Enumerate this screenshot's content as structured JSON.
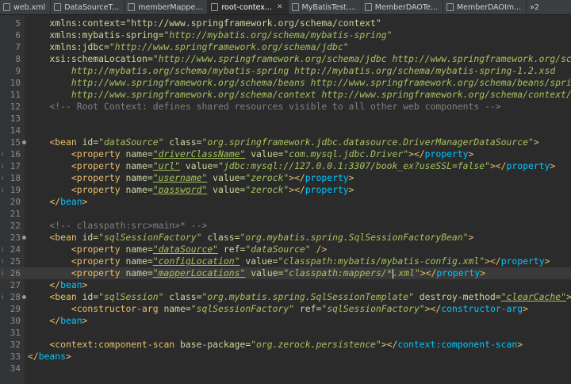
{
  "tabs": [
    {
      "label": "web.xml",
      "close": "",
      "active": false
    },
    {
      "label": "DataSourceT...",
      "close": "",
      "active": false
    },
    {
      "label": "memberMappe...",
      "close": "",
      "active": false
    },
    {
      "label": "root-contex...",
      "close": "✕",
      "active": true
    },
    {
      "label": "MyBatisTest....",
      "close": "",
      "active": false
    },
    {
      "label": "MemberDAOTe...",
      "close": "",
      "active": false
    },
    {
      "label": "MemberDAOIm...",
      "close": "",
      "active": false
    }
  ],
  "tab_overflow": "»2",
  "current_line": 26,
  "lines": [
    {
      "n": "5",
      "code": [
        [
          "a",
          "    xmlns:context=\"http://www.springframework.org/schema/context\""
        ]
      ]
    },
    {
      "n": "6",
      "code": [
        [
          "a",
          "    xmlns:mybatis-spring="
        ],
        [
          "v",
          "\"http://mybatis.org/schema/mybatis-spring\""
        ]
      ]
    },
    {
      "n": "7",
      "code": [
        [
          "a",
          "    xmlns:jdbc="
        ],
        [
          "v",
          "\"http://www.springframework.org/schema/jdbc\""
        ]
      ]
    },
    {
      "n": "8",
      "code": [
        [
          "a",
          "    xsi:schemaLocation="
        ],
        [
          "v",
          "\"http://www.springframework.org/schema/jdbc http://www.springframework.org/sch"
        ]
      ]
    },
    {
      "n": "9",
      "code": [
        [
          "v",
          "        http://mybatis.org/schema/mybatis-spring http://mybatis.org/schema/mybatis-spring-1.2.xsd"
        ]
      ]
    },
    {
      "n": "10",
      "code": [
        [
          "v",
          "        http://www.springframework.org/schema/beans http://www.springframework.org/schema/beans/spri"
        ]
      ]
    },
    {
      "n": "11",
      "code": [
        [
          "v",
          "        http://www.springframework.org/schema/context http://www.springframework.org/schema/context/"
        ]
      ]
    },
    {
      "n": "12",
      "code": [
        [
          "c",
          "    <!-- Root Context: defines shared resources visible to all other web components -->"
        ]
      ]
    },
    {
      "n": "13",
      "code": []
    },
    {
      "n": "14",
      "code": []
    },
    {
      "n": "15",
      "fold": true,
      "code": [
        [
          "t",
          "    <bean "
        ],
        [
          "a",
          "id="
        ],
        [
          "v",
          "\"dataSource\""
        ],
        [
          "a",
          " class="
        ],
        [
          "v",
          "\"org.springframework.jdbc.datasource.DriverManagerDataSource\""
        ],
        [
          "t",
          ">"
        ]
      ]
    },
    {
      "n": "16",
      "marker": "i",
      "code": [
        [
          "t",
          "        <property "
        ],
        [
          "a",
          "name="
        ],
        [
          "vu",
          "\"driverClassName\""
        ],
        [
          "a",
          " value="
        ],
        [
          "v",
          "\"com.mysql.jdbc.Driver\""
        ],
        [
          "t",
          "></"
        ],
        [
          "tb",
          "property"
        ],
        [
          "t",
          ">"
        ]
      ]
    },
    {
      "n": "17",
      "marker": "i",
      "code": [
        [
          "t",
          "        <property "
        ],
        [
          "a",
          "name="
        ],
        [
          "vu",
          "\"url\""
        ],
        [
          "a",
          " value="
        ],
        [
          "v",
          "\"jdbc:mysql://127.0.0.1:3307/book_ex?useSSL=false\""
        ],
        [
          "t",
          "></"
        ],
        [
          "tb",
          "property"
        ],
        [
          "t",
          ">"
        ]
      ]
    },
    {
      "n": "18",
      "marker": "i",
      "code": [
        [
          "t",
          "        <property "
        ],
        [
          "a",
          "name="
        ],
        [
          "vu",
          "\"username\""
        ],
        [
          "a",
          " value="
        ],
        [
          "v",
          "\"zerock\""
        ],
        [
          "t",
          "></"
        ],
        [
          "tb",
          "property"
        ],
        [
          "t",
          ">"
        ]
      ]
    },
    {
      "n": "19",
      "marker": "i",
      "code": [
        [
          "t",
          "        <property "
        ],
        [
          "a",
          "name="
        ],
        [
          "vu",
          "\"password\""
        ],
        [
          "a",
          " value="
        ],
        [
          "v",
          "\"zerock\""
        ],
        [
          "t",
          "></"
        ],
        [
          "tb",
          "property"
        ],
        [
          "t",
          ">"
        ]
      ]
    },
    {
      "n": "20",
      "code": [
        [
          "t",
          "    </"
        ],
        [
          "tb",
          "bean"
        ],
        [
          "t",
          ">"
        ]
      ]
    },
    {
      "n": "21",
      "code": []
    },
    {
      "n": "22",
      "code": [
        [
          "c",
          "    <!-- classpath:src>main>* -->"
        ]
      ]
    },
    {
      "n": "23",
      "fold": true,
      "code": [
        [
          "t",
          "    <bean "
        ],
        [
          "a",
          "id="
        ],
        [
          "v",
          "\"sqlSessionFactory\""
        ],
        [
          "a",
          " class="
        ],
        [
          "v",
          "\"org.mybatis.spring.SqlSessionFactoryBean\""
        ],
        [
          "t",
          ">"
        ]
      ]
    },
    {
      "n": "24",
      "marker": "i",
      "code": [
        [
          "t",
          "        <property "
        ],
        [
          "a",
          "name="
        ],
        [
          "vu",
          "\"dataSource\""
        ],
        [
          "a",
          " ref="
        ],
        [
          "v",
          "\"dataSource\""
        ],
        [
          "t",
          " />"
        ]
      ]
    },
    {
      "n": "25",
      "marker": "i",
      "code": [
        [
          "t",
          "        <property "
        ],
        [
          "a",
          "name="
        ],
        [
          "vu",
          "\"configLocation\""
        ],
        [
          "a",
          " value="
        ],
        [
          "v",
          "\"classpath:mybatis/mybatis-config.xml\""
        ],
        [
          "t",
          "></"
        ],
        [
          "tb",
          "property"
        ],
        [
          "t",
          ">"
        ]
      ]
    },
    {
      "n": "26",
      "marker": "i",
      "code": [
        [
          "t",
          "        <property "
        ],
        [
          "a",
          "name="
        ],
        [
          "vu",
          "\"mapperLocations\""
        ],
        [
          "a",
          " value="
        ],
        [
          "v",
          "\"classpath:mappers/*"
        ],
        [
          "cursor",
          ""
        ],
        [
          "v",
          ".xml\""
        ],
        [
          "t",
          "></"
        ],
        [
          "tb",
          "property"
        ],
        [
          "t",
          ">"
        ]
      ]
    },
    {
      "n": "27",
      "code": [
        [
          "t",
          "    </"
        ],
        [
          "tb",
          "bean"
        ],
        [
          "t",
          ">"
        ]
      ]
    },
    {
      "n": "28",
      "fold": true,
      "marker": "i",
      "code": [
        [
          "t",
          "    <bean "
        ],
        [
          "a",
          "id="
        ],
        [
          "v",
          "\"sqlSession\""
        ],
        [
          "a",
          " class="
        ],
        [
          "v",
          "\"org.mybatis.spring.SqlSessionTemplate\""
        ],
        [
          "a",
          " destroy-method="
        ],
        [
          "vu",
          "\"clearCache\""
        ],
        [
          "t",
          ">"
        ]
      ]
    },
    {
      "n": "29",
      "code": [
        [
          "t",
          "        <constructor-arg "
        ],
        [
          "a",
          "name="
        ],
        [
          "v",
          "\"sqlSessionFactory\""
        ],
        [
          "a",
          " ref="
        ],
        [
          "v",
          "\"sqlSessionFactory\""
        ],
        [
          "t",
          "></"
        ],
        [
          "tb",
          "constructor-arg"
        ],
        [
          "t",
          ">"
        ]
      ]
    },
    {
      "n": "30",
      "code": [
        [
          "t",
          "    </"
        ],
        [
          "tb",
          "bean"
        ],
        [
          "t",
          ">"
        ]
      ]
    },
    {
      "n": "31",
      "code": []
    },
    {
      "n": "32",
      "code": [
        [
          "t",
          "    <context:component-scan "
        ],
        [
          "a",
          "base-package="
        ],
        [
          "v",
          "\"org.zerock.persistence\""
        ],
        [
          "t",
          "></"
        ],
        [
          "tb",
          "context:component-scan"
        ],
        [
          "t",
          ">"
        ]
      ]
    },
    {
      "n": "33",
      "code": [
        [
          "t",
          "</"
        ],
        [
          "tb",
          "beans"
        ],
        [
          "t",
          ">"
        ]
      ]
    },
    {
      "n": "34",
      "code": []
    }
  ]
}
